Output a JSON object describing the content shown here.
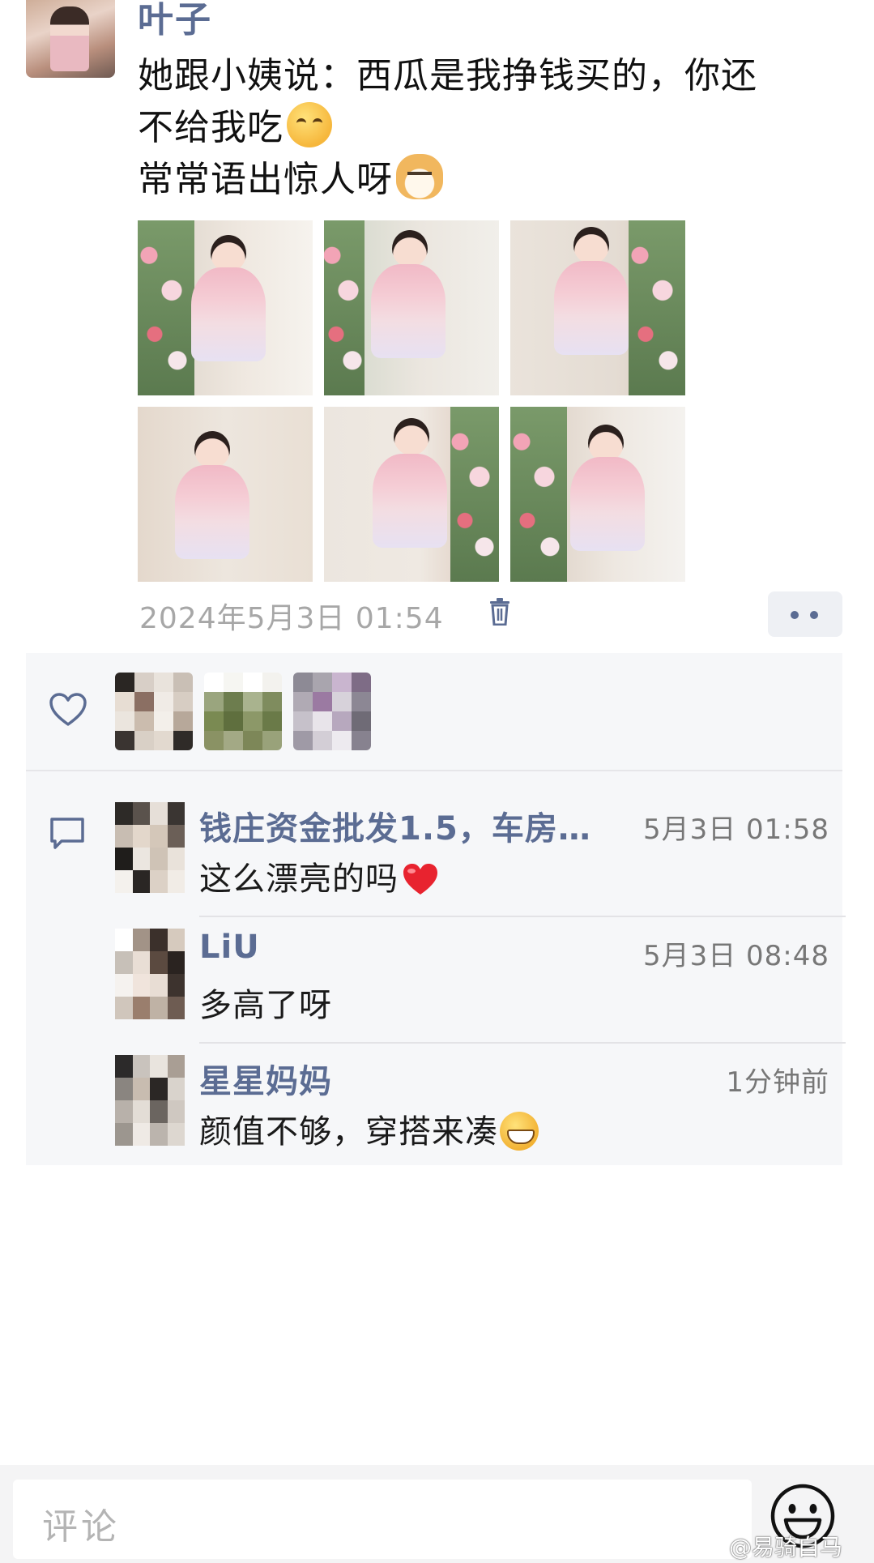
{
  "post": {
    "author": "叶子",
    "text_lines": [
      "她跟小姨说：西瓜是我挣钱买的，你还",
      "不给我吃",
      "常常语出惊人呀"
    ],
    "timestamp": "2024年5月3日 01:54",
    "photo_count": 6
  },
  "likes": {
    "avatar_count": 3
  },
  "comments": [
    {
      "name": "钱庄资金批发1.5，车房…",
      "time": "5月3日 01:58",
      "text": "这么漂亮的吗"
    },
    {
      "name": "LiU",
      "time": "5月3日 08:48",
      "text": "多高了呀"
    },
    {
      "name": "星星妈妈",
      "time": "1分钟前",
      "text": "颜值不够，穿搭来凑"
    }
  ],
  "input": {
    "placeholder": "评论"
  },
  "watermark": "@易骑自马",
  "colors": {
    "name_blue": "#5b6c93",
    "panel_bg": "#f6f7f9",
    "timestamp_gray": "#a7a7a7"
  },
  "icons": [
    "trash-icon",
    "more-dots-icon",
    "heart-icon",
    "comment-icon",
    "emoji-button-icon",
    "weibo-icon"
  ]
}
